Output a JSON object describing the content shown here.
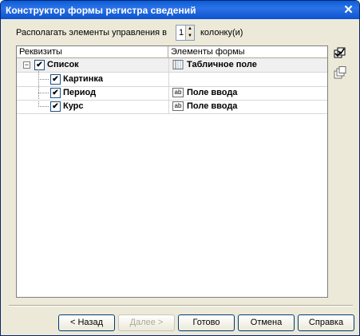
{
  "window": {
    "title": "Конструктор формы регистра сведений",
    "close_glyph": "✕"
  },
  "columns": {
    "label": "Располагать элементы управления в",
    "value": "1",
    "suffix": "колонку(и)"
  },
  "grid": {
    "headers": [
      "Реквизиты",
      "Элементы формы"
    ],
    "rows": [
      {
        "name": "Список",
        "element": "Табличное поле",
        "icon": "table-field-icon",
        "checked": "✔"
      },
      {
        "name": "Картинка",
        "element": "",
        "icon": "",
        "checked": "✔"
      },
      {
        "name": "Период",
        "element": "Поле ввода",
        "icon": "input-field-icon",
        "checked": "✔"
      },
      {
        "name": "Курс",
        "element": "Поле ввода",
        "icon": "input-field-icon",
        "checked": "✔"
      }
    ],
    "expander_glyph": "−",
    "field_icon_text": "ab"
  },
  "buttons": {
    "back": "< Назад",
    "next": "Далее >",
    "done": "Готово",
    "cancel": "Отмена",
    "help": "Справка"
  },
  "colors": {
    "titlebar": "#0b53cf",
    "face": "#ece9d8"
  }
}
